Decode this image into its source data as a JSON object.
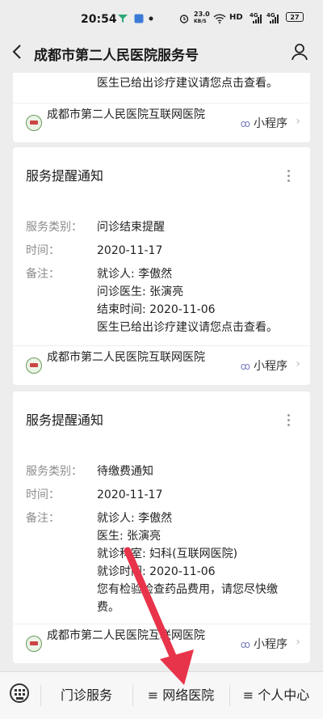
{
  "status": {
    "time": "20:54",
    "net_speed": "23.0",
    "net_unit": "KB/S",
    "hd": "HD",
    "g1": "4G",
    "g2": "4G",
    "battery": "27"
  },
  "header": {
    "title": "成都市第二人民医院服务号"
  },
  "cards": [
    {
      "partial_text": "医生已给出诊疗建议请您点击查看。",
      "footer": {
        "name": "成都市第二人民医院互联网医院",
        "mini": "小程序"
      }
    },
    {
      "title": "服务提醒通知",
      "rows": [
        {
          "k": "服务类别：",
          "v": "问诊结束提醒"
        },
        {
          "k": "时间：",
          "v": "2020-11-17"
        },
        {
          "k": "备注：",
          "v": [
            "就诊人: 李傲然",
            "问诊医生: 张演亮",
            "结束时间: 2020-11-06",
            "医生已给出诊疗建议请您点击查看。"
          ]
        }
      ],
      "footer": {
        "name": "成都市第二人民医院互联网医院",
        "mini": "小程序"
      }
    },
    {
      "title": "服务提醒通知",
      "rows": [
        {
          "k": "服务类别：",
          "v": "待缴费通知"
        },
        {
          "k": "时间：",
          "v": "2020-11-17"
        },
        {
          "k": "备注：",
          "v": [
            "就诊人: 李傲然",
            "医生: 张演亮",
            "就诊科室: 妇科(互联网医院)",
            "就诊时间: 2020-11-06",
            "您有检验检查药品费用，请您尽快缴",
            "费。"
          ]
        }
      ],
      "footer": {
        "name": "成都市第二人民医院互联网医院",
        "mini": "小程序"
      }
    }
  ],
  "bottom_tabs": [
    {
      "label": "门诊服务",
      "prefix": ""
    },
    {
      "label": "网络医院",
      "prefix": "≡ "
    },
    {
      "label": "个人中心",
      "prefix": "≡ "
    }
  ],
  "colors": {
    "arrow": "#e8344a",
    "mini_icon": "#7a7fbf"
  }
}
